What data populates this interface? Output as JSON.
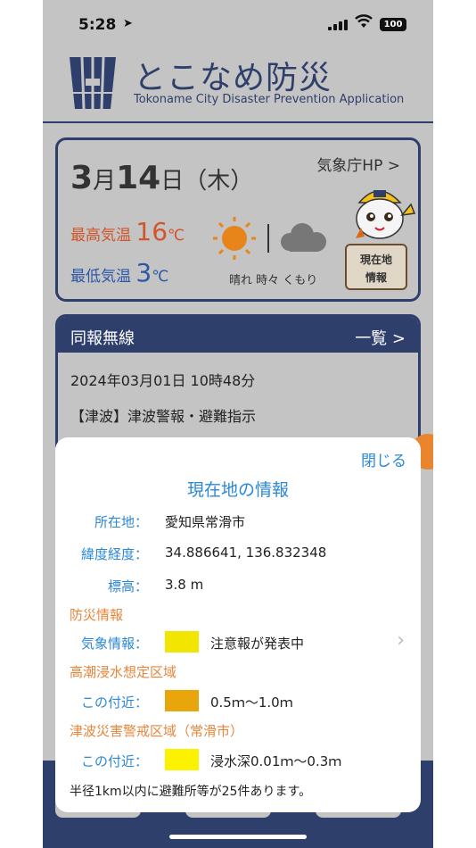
{
  "status_bar": {
    "time": "5:28",
    "location_icon": "location-arrow-icon",
    "battery": "100"
  },
  "app": {
    "title": "とこなめ防災",
    "subtitle": "Tokoname City Disaster Prevention Application"
  },
  "weather": {
    "date_month": "3",
    "date_month_suffix": "月",
    "date_day": "14",
    "date_day_suffix": "日",
    "weekday": "（木）",
    "jma_link": "気象庁HP >",
    "high_label": "最高気温",
    "high_value": "16",
    "high_unit": "℃",
    "low_label": "最低気温",
    "low_value": "3",
    "low_unit": "℃",
    "condition": "晴れ 時々 くもり",
    "here_button_line1": "現在地",
    "here_button_line2": "情報"
  },
  "broadcast": {
    "header": "同報無線",
    "list_link": "一覧 >",
    "date": "2024年03月01日 10時48分",
    "message": "【津波】津波警報・避難指示"
  },
  "popup": {
    "close": "閉じる",
    "title": "現在地の情報",
    "address_label": "所在地：",
    "address_value": "愛知県常滑市",
    "coords_label": "緯度経度：",
    "coords_value": "34.886641, 136.832348",
    "elevation_label": "標高：",
    "elevation_value": "3.8 m",
    "section_disaster": "防災情報",
    "weather_info_label": "気象情報：",
    "weather_info_value": "注意報が発表中",
    "section_tide": "高潮浸水想定区域",
    "tide_label": "この付近：",
    "tide_value": "0.5ｍ～1.0ｍ",
    "section_tsunami": "津波災害警戒区域（常滑市）",
    "tsunami_label": "この付近：",
    "tsunami_value": "浸水深0.01ｍ～0.3ｍ",
    "footer": "半径1km以内に避難所等が25件あります。"
  },
  "colors": {
    "navy": "#2f3f6b",
    "link_blue": "#2b88d8",
    "section_orange": "#e8853a",
    "swatch_weather": "#f2e600",
    "swatch_tide": "#e9a60c",
    "swatch_tsunami": "#fbf200"
  }
}
